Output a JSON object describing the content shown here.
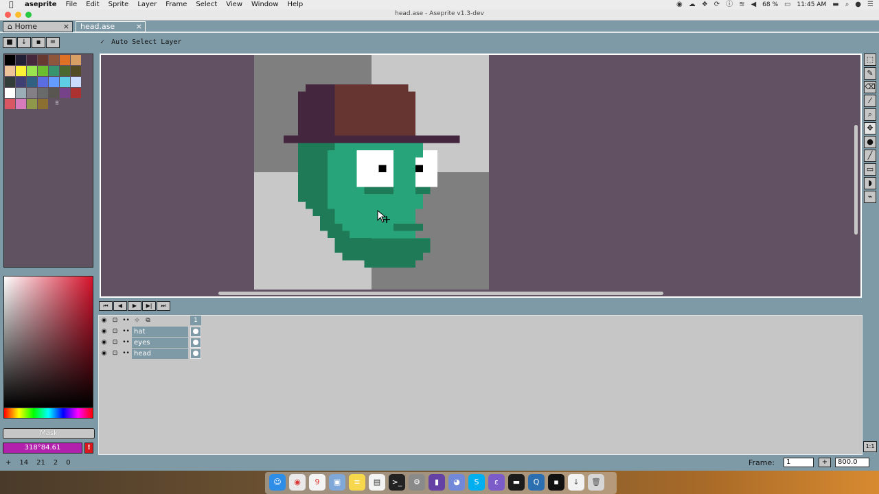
{
  "menubar": {
    "apple": "",
    "items": [
      "aseprite",
      "File",
      "Edit",
      "Sprite",
      "Layer",
      "Frame",
      "Select",
      "View",
      "Window",
      "Help"
    ],
    "battery": "68 %",
    "time": "11:45 AM"
  },
  "window": {
    "title": "head.ase - Aseprite v1.3-dev"
  },
  "tabs": [
    {
      "label": "Home",
      "icon": "home-icon",
      "close": "×"
    },
    {
      "label": "head.ase",
      "close": "×"
    }
  ],
  "palette_toolbar": [
    "lock-icon",
    "down-arrow-icon",
    "save-icon",
    "menu-icon"
  ],
  "palette": {
    "colors": [
      "#000000",
      "#222034",
      "#45283c",
      "#663931",
      "#8f563b",
      "#df7126",
      "#d9a066",
      "#eec39a",
      "#fbf236",
      "#99e550",
      "#6abe30",
      "#37946e",
      "#4b692f",
      "#524b24",
      "#323c39",
      "#3f3f74",
      "#306082",
      "#5b6ee1",
      "#639bff",
      "#5fcde4",
      "#cbdbfc",
      "#ffffff",
      "#9badb7",
      "#847e87",
      "#696a6a",
      "#595652",
      "#76428a",
      "#ac3232",
      "#d95763",
      "#d77bba",
      "#8f974a",
      "#8a6f30"
    ],
    "more": "⠿"
  },
  "mask_label": "Mask",
  "color_value": "318°84.61",
  "context_bar": {
    "check": "✓",
    "label": "Auto Select Layer"
  },
  "tools": [
    "marquee-icon",
    "pencil-icon",
    "eraser-icon",
    "eyedropper-icon",
    "zoom-icon",
    "move-icon",
    "fill-icon",
    "line-icon",
    "rectangle-icon",
    "contour-icon",
    "blur-icon"
  ],
  "anim_controls": [
    "⏮",
    "◀",
    "▶",
    "▶|",
    "⏭"
  ],
  "timeline": {
    "frame_number": "1",
    "layers": [
      "hat",
      "eyes",
      "head"
    ]
  },
  "status": {
    "pos": [
      "14",
      "21",
      "2",
      "0"
    ],
    "frame_label": "Frame:",
    "frame_value": "1",
    "zoom_value": "800.0",
    "zoom_one": "1:1"
  },
  "sprite_colors": {
    "checker_dark": "#7f7f7f",
    "checker_light": "#c8c8c8",
    "hat_shadow": "#45263f",
    "hat": "#663531",
    "head_shade": "#1f7a58",
    "head": "#27a47a",
    "eye_white": "#ffffff",
    "pupil": "#000000"
  }
}
